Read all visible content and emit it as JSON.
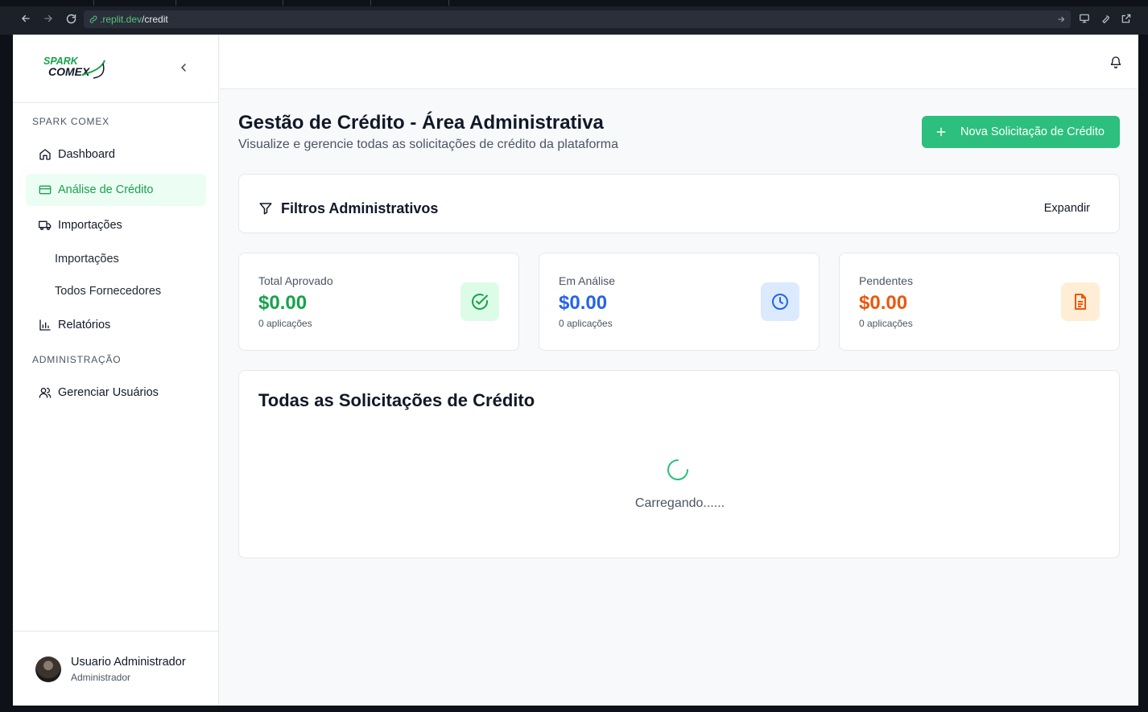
{
  "browser": {
    "url_domain": ".replit.dev",
    "url_path": "/credit"
  },
  "sidebar": {
    "section_main": "SPARK COMEX",
    "items": [
      {
        "label": "Dashboard",
        "icon": "home-icon"
      },
      {
        "label": "Análise de Crédito",
        "icon": "credit-card-icon",
        "active": true
      },
      {
        "label": "Importações",
        "icon": "truck-icon"
      }
    ],
    "sub_items": [
      "Importações",
      "Todos Fornecedores"
    ],
    "reports": {
      "label": "Relatórios",
      "icon": "bar-chart-icon"
    },
    "section_admin": "ADMINISTRAÇÃO",
    "admin_items": [
      {
        "label": "Gerenciar Usuários",
        "icon": "users-icon"
      }
    ],
    "user": {
      "name": "Usuario Administrador",
      "role": "Administrador"
    }
  },
  "header": {
    "notification_icon": "bell-icon"
  },
  "page": {
    "title": "Gestão de Crédito - Área Administrativa",
    "subtitle": "Visualize e gerencie todas as solicitações de crédito da plataforma",
    "new_button": "Nova Solicitação de Crédito"
  },
  "filters": {
    "title": "Filtros Administrativos",
    "expand_label": "Expandir"
  },
  "stats": [
    {
      "label": "Total Aprovado",
      "value": "$0.00",
      "count": "0 aplicações",
      "color": "#16a34a",
      "badge_bg": "#dcfce7",
      "icon": "check-circle-icon"
    },
    {
      "label": "Em Análise",
      "value": "$0.00",
      "count": "0 aplicações",
      "color": "#2563eb",
      "badge_bg": "#dbeafe",
      "icon": "clock-icon"
    },
    {
      "label": "Pendentes",
      "value": "$0.00",
      "count": "0 aplicações",
      "color": "#ea580c",
      "badge_bg": "#ffedd5",
      "icon": "document-icon"
    }
  ],
  "requests": {
    "title": "Todas as Solicitações de Crédito",
    "loading_text": "Carregando......"
  },
  "colors": {
    "accent": "#2cbf7d",
    "active_bg": "#ecfdf3",
    "active_text": "#16a34a"
  }
}
